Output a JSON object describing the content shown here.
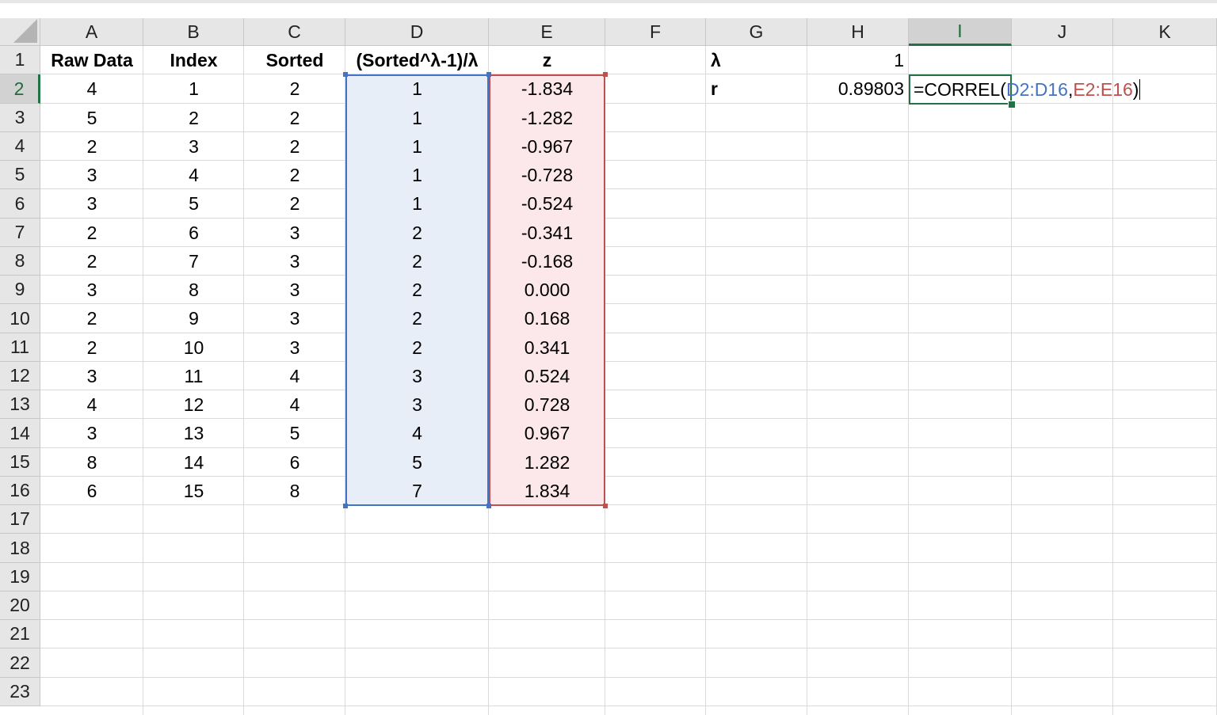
{
  "columns": [
    "A",
    "B",
    "C",
    "D",
    "E",
    "F",
    "G",
    "H",
    "I",
    "J",
    "K"
  ],
  "active_column": "I",
  "rows": [
    "1",
    "2",
    "3",
    "4",
    "5",
    "6",
    "7",
    "8",
    "9",
    "10",
    "11",
    "12",
    "13",
    "14",
    "15",
    "16",
    "17",
    "18",
    "19",
    "20",
    "21",
    "22",
    "23"
  ],
  "active_row": "2",
  "headers": {
    "raw_data": "Raw Data",
    "index": "Index",
    "sorted": "Sorted",
    "transform": "(Sorted^λ-1)/λ",
    "z": "z"
  },
  "data_rows": [
    {
      "raw": "4",
      "index": "1",
      "sorted": "2",
      "transformed": "1",
      "z": "-1.834"
    },
    {
      "raw": "5",
      "index": "2",
      "sorted": "2",
      "transformed": "1",
      "z": "-1.282"
    },
    {
      "raw": "2",
      "index": "3",
      "sorted": "2",
      "transformed": "1",
      "z": "-0.967"
    },
    {
      "raw": "3",
      "index": "4",
      "sorted": "2",
      "transformed": "1",
      "z": "-0.728"
    },
    {
      "raw": "3",
      "index": "5",
      "sorted": "2",
      "transformed": "1",
      "z": "-0.524"
    },
    {
      "raw": "2",
      "index": "6",
      "sorted": "3",
      "transformed": "2",
      "z": "-0.341"
    },
    {
      "raw": "2",
      "index": "7",
      "sorted": "3",
      "transformed": "2",
      "z": "-0.168"
    },
    {
      "raw": "3",
      "index": "8",
      "sorted": "3",
      "transformed": "2",
      "z": "0.000"
    },
    {
      "raw": "2",
      "index": "9",
      "sorted": "3",
      "transformed": "2",
      "z": "0.168"
    },
    {
      "raw": "2",
      "index": "10",
      "sorted": "3",
      "transformed": "2",
      "z": "0.341"
    },
    {
      "raw": "3",
      "index": "11",
      "sorted": "4",
      "transformed": "3",
      "z": "0.524"
    },
    {
      "raw": "4",
      "index": "12",
      "sorted": "4",
      "transformed": "3",
      "z": "0.728"
    },
    {
      "raw": "3",
      "index": "13",
      "sorted": "5",
      "transformed": "4",
      "z": "0.967"
    },
    {
      "raw": "8",
      "index": "14",
      "sorted": "6",
      "transformed": "5",
      "z": "1.282"
    },
    {
      "raw": "6",
      "index": "15",
      "sorted": "8",
      "transformed": "7",
      "z": "1.834"
    }
  ],
  "params": {
    "lambda_label": "λ",
    "lambda_value": "1",
    "r_label": "r",
    "r_value": "0.89803"
  },
  "formula": {
    "prefix": "=CORREL(",
    "range1": "D2:D16",
    "separator": ", ",
    "range2": "E2:E16",
    "suffix": ")"
  },
  "colors": {
    "selection_green": "#217346",
    "range_blue": "#4472c4",
    "range_red": "#c0504d"
  }
}
